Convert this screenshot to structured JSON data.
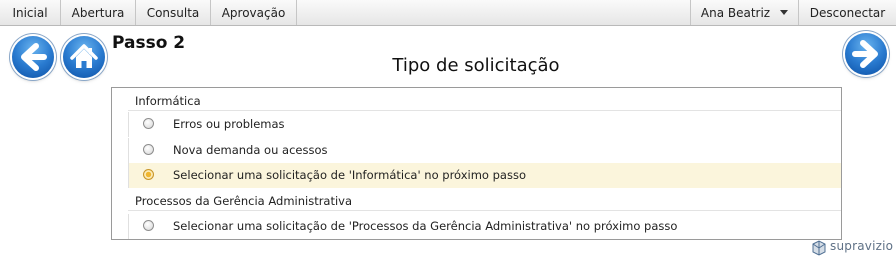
{
  "topnav": {
    "items": [
      {
        "label": "Inicial"
      },
      {
        "label": "Abertura"
      },
      {
        "label": "Consulta"
      },
      {
        "label": "Aprovação"
      }
    ],
    "user_label": "Ana Beatriz",
    "logout_label": "Desconectar"
  },
  "header": {
    "step_label": "Passo 2",
    "title": "Tipo de solicitação"
  },
  "groups": [
    {
      "label": "Informática",
      "options": [
        {
          "label": "Erros ou problemas",
          "selected": false
        },
        {
          "label": "Nova demanda ou acessos",
          "selected": false
        },
        {
          "label": "Selecionar uma solicitação de 'Informática' no próximo passo",
          "selected": true
        }
      ]
    },
    {
      "label": "Processos da Gerência Administrativa",
      "options": [
        {
          "label": "Selecionar uma solicitação de 'Processos da Gerência Administrativa' no próximo passo",
          "selected": false
        }
      ]
    }
  ],
  "brand": "supravizio",
  "colors": {
    "button_blue": "#2a7bd0",
    "selected_row": "#fbf5dc",
    "radio_selected": "#f0b630"
  },
  "icons": {
    "back": "arrow-left-icon",
    "home": "home-icon",
    "next": "arrow-right-icon"
  }
}
